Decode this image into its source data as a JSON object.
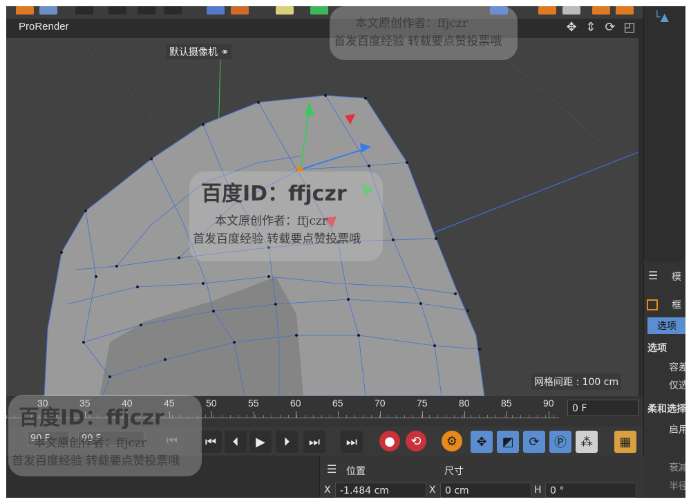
{
  "viewport": {
    "title": "ProRender",
    "camera_label": "默认摄像机",
    "grid_spacing": "网格间距 : 100 cm"
  },
  "timeline": {
    "ticks": [
      "30",
      "35",
      "40",
      "45",
      "50",
      "55",
      "60",
      "65",
      "70",
      "75",
      "80",
      "85",
      "90"
    ],
    "current_frame": "0 F"
  },
  "transport": {
    "start_value": "90 F",
    "end_value": "90 F"
  },
  "attributes": {
    "position_label": "位置",
    "size_label": "尺寸",
    "x_label": "X",
    "x_value": "-1.484 cm",
    "x2_label": "X",
    "size_x_value": "0 cm",
    "h_label": "H",
    "h_value": "0 °"
  },
  "right_panel": {
    "mode_label": "模",
    "frame_label": "框",
    "options_tab": "选项",
    "options_heading": "选项",
    "item_1": "容差",
    "item_2": "仅选",
    "soft_select": "柔和选择",
    "enable": "启用",
    "item_3": "衰减",
    "item_4": "半径"
  },
  "watermark": {
    "id_text": "百度ID：ffjczr",
    "author_line": "本文原创作者：ffjczr",
    "promo_line": "首发百度经验 转载要点赞投票哦"
  },
  "colors": {
    "viewport_bg": "#424242",
    "mesh": "#9a9a9a",
    "mesh_edge": "#3d6fd8",
    "axis_green": "#3ec85a",
    "axis_red": "#e0323c",
    "axis_blue": "#3a7be8"
  }
}
